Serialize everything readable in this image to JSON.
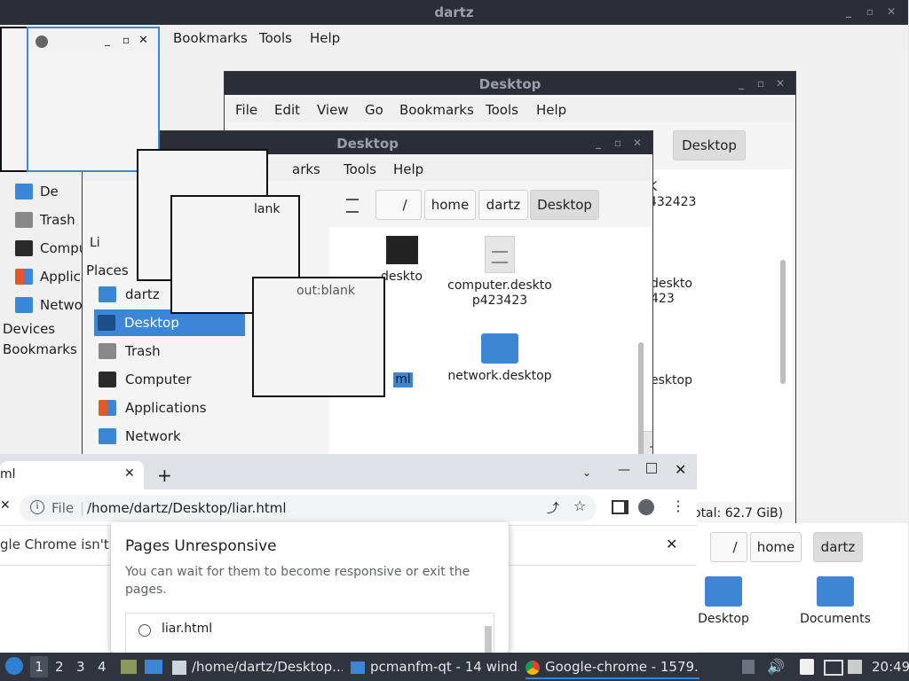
{
  "back_window": {
    "title": "dartz",
    "menu": [
      "Bookmarks",
      "Tools",
      "Help"
    ],
    "sidebar_items": [
      "De",
      "Trash",
      "Compu",
      "Applica",
      "Netwo"
    ],
    "section_devices": "Devices",
    "section_bookmarks": "Bookmarks"
  },
  "desktop_window_back": {
    "title": "Desktop",
    "menu": [
      "File",
      "Edit",
      "View",
      "Go",
      "Bookmarks",
      "Tools",
      "Help"
    ],
    "crumb_active": "Desktop",
    "files": [
      "K\n432423",
      "deskto\n423",
      "esktop"
    ],
    "status": "otal: 62.7 GiB)"
  },
  "desktop_window_front": {
    "title": "Desktop",
    "menu": [
      "arks",
      "Tools",
      "Help"
    ],
    "crumbs": [
      "/",
      "home",
      "dartz",
      "Desktop"
    ],
    "places_label": "Places",
    "lists_label": "Li",
    "places": [
      "dartz",
      "Desktop",
      "Trash",
      "Computer",
      "Applications",
      "Network"
    ],
    "files": {
      "f1": "desktо",
      "f2": "computer.deskto\np423423",
      "f3": "ml",
      "f4": "network.desktop"
    }
  },
  "ghost": {
    "about_blank": "out:blank",
    "blank": "lank"
  },
  "file_manager_lower": {
    "crumbs": [
      "/",
      "home",
      "dartz"
    ],
    "items": [
      "Desktop",
      "Documents"
    ]
  },
  "chrome": {
    "tab_title": "ml",
    "new_tab": "+",
    "scheme": "File",
    "url": "/home/dartz/Desktop/liar.html",
    "infobar_text": "gle Chrome isn't y",
    "dialog_title": "Pages Unresponsive",
    "dialog_body": "You can wait for them to become responsive or exit the pages.",
    "dialog_item": "liar.html"
  },
  "taskbar": {
    "workspaces": [
      "1",
      "2",
      "3",
      "4"
    ],
    "tasks": [
      "/home/dartz/Desktop...",
      "pcmanfm-qt - 14 wind...",
      "Google-chrome - 1579..."
    ],
    "clock": "20:49"
  },
  "colors": {
    "titlebar": "#2b2e37",
    "accent": "#3b86d6",
    "taskbar": "#2f343f"
  }
}
